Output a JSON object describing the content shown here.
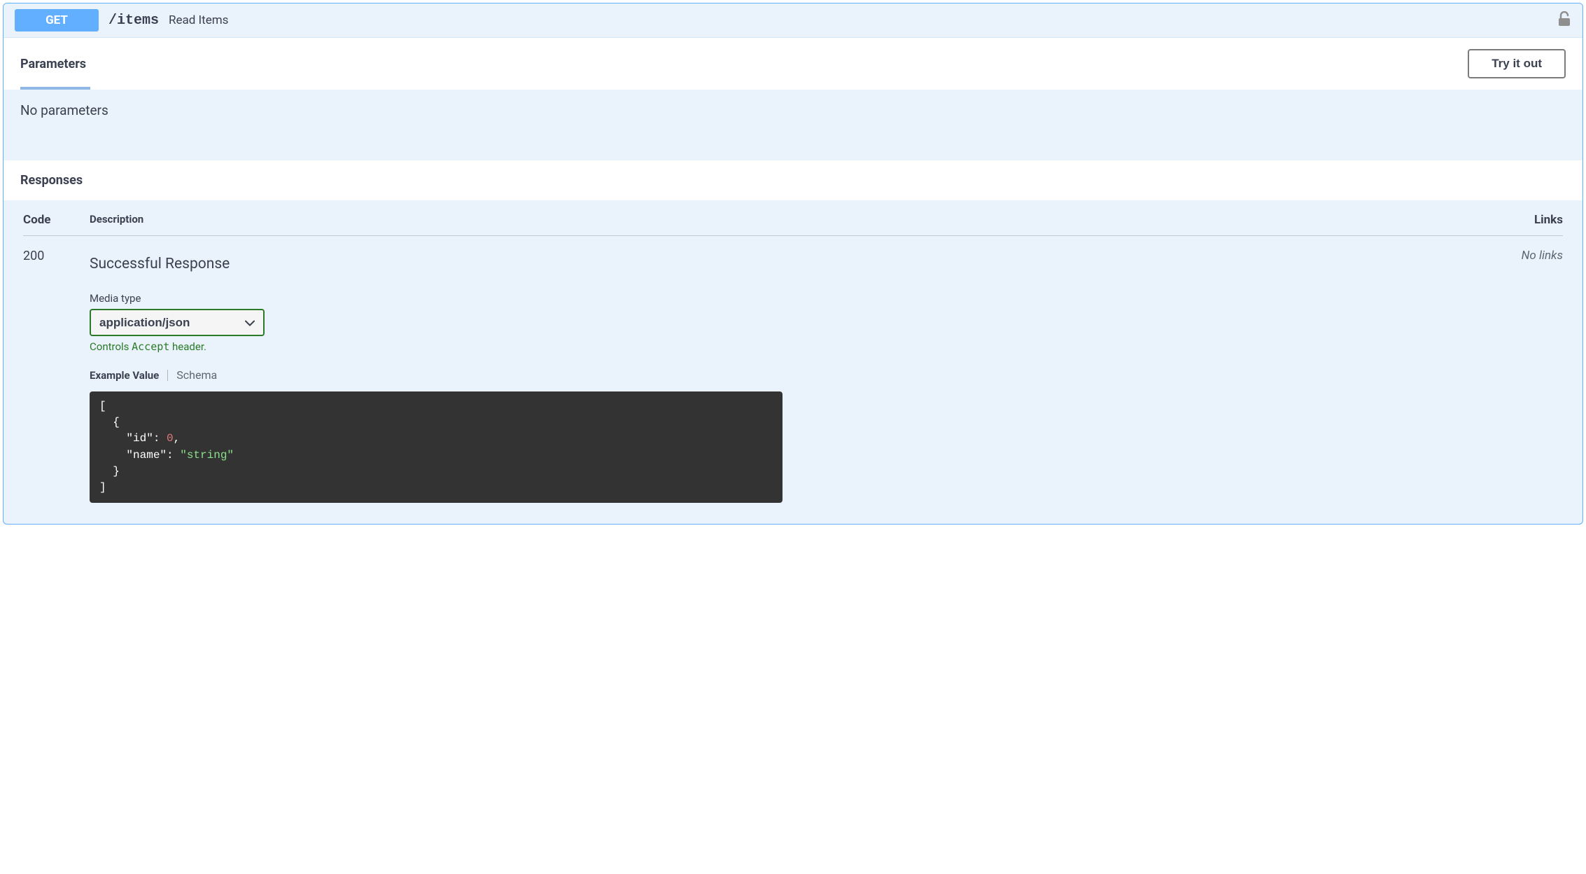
{
  "header": {
    "method": "GET",
    "path": "/items",
    "summary": "Read Items"
  },
  "parameters": {
    "title": "Parameters",
    "tryItOut": "Try it out",
    "noParams": "No parameters"
  },
  "responses": {
    "title": "Responses",
    "columns": {
      "code": "Code",
      "description": "Description",
      "links": "Links"
    },
    "row": {
      "code": "200",
      "description": "Successful Response",
      "noLinks": "No links"
    },
    "mediaType": {
      "label": "Media type",
      "selected": "application/json",
      "notePrefix": "Controls ",
      "noteMono": "Accept",
      "noteSuffix": " header."
    },
    "tabs": {
      "exampleValue": "Example Value",
      "schema": "Schema"
    },
    "example": {
      "open1": "[",
      "open2": "  {",
      "line1key": "    \"id\"",
      "line1colon": ": ",
      "line1val": "0",
      "line1comma": ",",
      "line2key": "    \"name\"",
      "line2colon": ": ",
      "line2val": "\"string\"",
      "close2": "  }",
      "close1": "]"
    }
  }
}
